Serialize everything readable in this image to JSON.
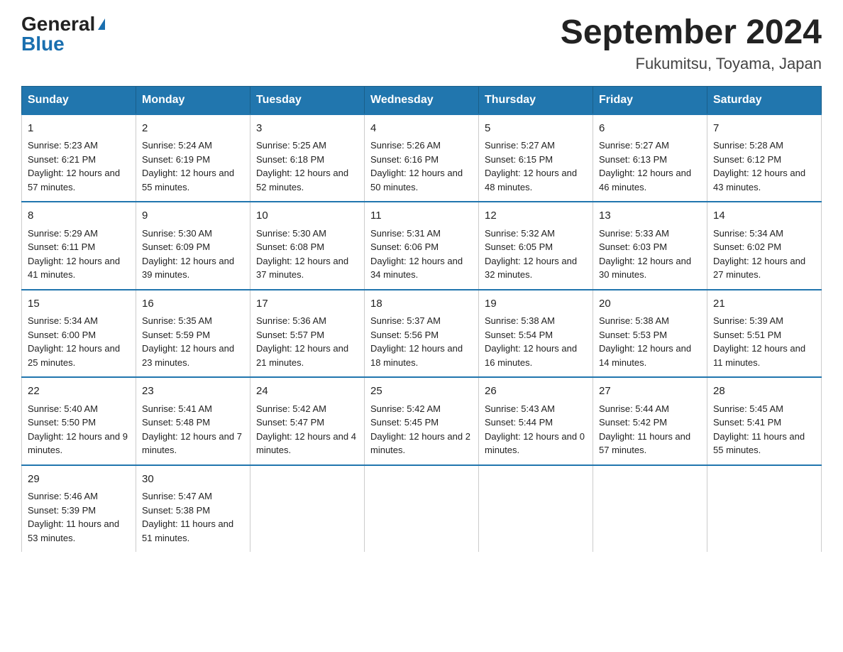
{
  "logo": {
    "general": "General",
    "blue": "Blue"
  },
  "header": {
    "month_year": "September 2024",
    "location": "Fukumitsu, Toyama, Japan"
  },
  "days_of_week": [
    "Sunday",
    "Monday",
    "Tuesday",
    "Wednesday",
    "Thursday",
    "Friday",
    "Saturday"
  ],
  "weeks": [
    [
      {
        "day": "1",
        "sunrise": "5:23 AM",
        "sunset": "6:21 PM",
        "daylight": "12 hours and 57 minutes."
      },
      {
        "day": "2",
        "sunrise": "5:24 AM",
        "sunset": "6:19 PM",
        "daylight": "12 hours and 55 minutes."
      },
      {
        "day": "3",
        "sunrise": "5:25 AM",
        "sunset": "6:18 PM",
        "daylight": "12 hours and 52 minutes."
      },
      {
        "day": "4",
        "sunrise": "5:26 AM",
        "sunset": "6:16 PM",
        "daylight": "12 hours and 50 minutes."
      },
      {
        "day": "5",
        "sunrise": "5:27 AM",
        "sunset": "6:15 PM",
        "daylight": "12 hours and 48 minutes."
      },
      {
        "day": "6",
        "sunrise": "5:27 AM",
        "sunset": "6:13 PM",
        "daylight": "12 hours and 46 minutes."
      },
      {
        "day": "7",
        "sunrise": "5:28 AM",
        "sunset": "6:12 PM",
        "daylight": "12 hours and 43 minutes."
      }
    ],
    [
      {
        "day": "8",
        "sunrise": "5:29 AM",
        "sunset": "6:11 PM",
        "daylight": "12 hours and 41 minutes."
      },
      {
        "day": "9",
        "sunrise": "5:30 AM",
        "sunset": "6:09 PM",
        "daylight": "12 hours and 39 minutes."
      },
      {
        "day": "10",
        "sunrise": "5:30 AM",
        "sunset": "6:08 PM",
        "daylight": "12 hours and 37 minutes."
      },
      {
        "day": "11",
        "sunrise": "5:31 AM",
        "sunset": "6:06 PM",
        "daylight": "12 hours and 34 minutes."
      },
      {
        "day": "12",
        "sunrise": "5:32 AM",
        "sunset": "6:05 PM",
        "daylight": "12 hours and 32 minutes."
      },
      {
        "day": "13",
        "sunrise": "5:33 AM",
        "sunset": "6:03 PM",
        "daylight": "12 hours and 30 minutes."
      },
      {
        "day": "14",
        "sunrise": "5:34 AM",
        "sunset": "6:02 PM",
        "daylight": "12 hours and 27 minutes."
      }
    ],
    [
      {
        "day": "15",
        "sunrise": "5:34 AM",
        "sunset": "6:00 PM",
        "daylight": "12 hours and 25 minutes."
      },
      {
        "day": "16",
        "sunrise": "5:35 AM",
        "sunset": "5:59 PM",
        "daylight": "12 hours and 23 minutes."
      },
      {
        "day": "17",
        "sunrise": "5:36 AM",
        "sunset": "5:57 PM",
        "daylight": "12 hours and 21 minutes."
      },
      {
        "day": "18",
        "sunrise": "5:37 AM",
        "sunset": "5:56 PM",
        "daylight": "12 hours and 18 minutes."
      },
      {
        "day": "19",
        "sunrise": "5:38 AM",
        "sunset": "5:54 PM",
        "daylight": "12 hours and 16 minutes."
      },
      {
        "day": "20",
        "sunrise": "5:38 AM",
        "sunset": "5:53 PM",
        "daylight": "12 hours and 14 minutes."
      },
      {
        "day": "21",
        "sunrise": "5:39 AM",
        "sunset": "5:51 PM",
        "daylight": "12 hours and 11 minutes."
      }
    ],
    [
      {
        "day": "22",
        "sunrise": "5:40 AM",
        "sunset": "5:50 PM",
        "daylight": "12 hours and 9 minutes."
      },
      {
        "day": "23",
        "sunrise": "5:41 AM",
        "sunset": "5:48 PM",
        "daylight": "12 hours and 7 minutes."
      },
      {
        "day": "24",
        "sunrise": "5:42 AM",
        "sunset": "5:47 PM",
        "daylight": "12 hours and 4 minutes."
      },
      {
        "day": "25",
        "sunrise": "5:42 AM",
        "sunset": "5:45 PM",
        "daylight": "12 hours and 2 minutes."
      },
      {
        "day": "26",
        "sunrise": "5:43 AM",
        "sunset": "5:44 PM",
        "daylight": "12 hours and 0 minutes."
      },
      {
        "day": "27",
        "sunrise": "5:44 AM",
        "sunset": "5:42 PM",
        "daylight": "11 hours and 57 minutes."
      },
      {
        "day": "28",
        "sunrise": "5:45 AM",
        "sunset": "5:41 PM",
        "daylight": "11 hours and 55 minutes."
      }
    ],
    [
      {
        "day": "29",
        "sunrise": "5:46 AM",
        "sunset": "5:39 PM",
        "daylight": "11 hours and 53 minutes."
      },
      {
        "day": "30",
        "sunrise": "5:47 AM",
        "sunset": "5:38 PM",
        "daylight": "11 hours and 51 minutes."
      },
      {
        "day": "",
        "sunrise": "",
        "sunset": "",
        "daylight": ""
      },
      {
        "day": "",
        "sunrise": "",
        "sunset": "",
        "daylight": ""
      },
      {
        "day": "",
        "sunrise": "",
        "sunset": "",
        "daylight": ""
      },
      {
        "day": "",
        "sunrise": "",
        "sunset": "",
        "daylight": ""
      },
      {
        "day": "",
        "sunrise": "",
        "sunset": "",
        "daylight": ""
      }
    ]
  ]
}
